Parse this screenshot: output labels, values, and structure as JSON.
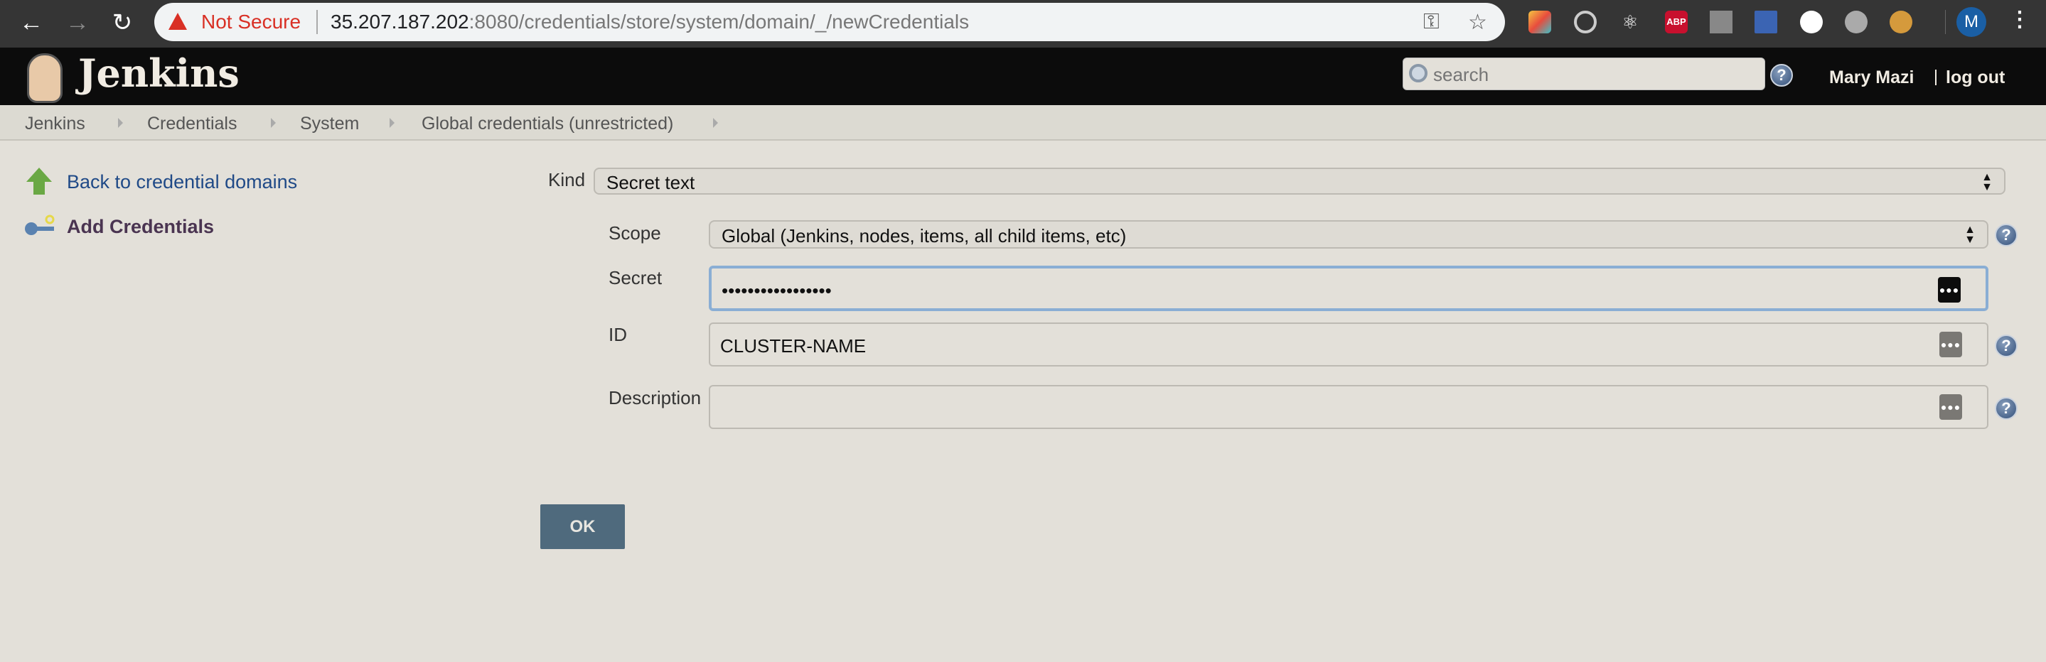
{
  "browser": {
    "security_label": "Not Secure",
    "url_host": "35.207.187.202",
    "url_rest": ":8080/credentials/store/system/domain/_/newCredentials",
    "profile_initial": "M",
    "extensions": [
      "pinwheel",
      "target",
      "react-devtools",
      "adblock-plus",
      "counter",
      "bookmark",
      "json-viewer",
      "ghost",
      "cookie-txt"
    ]
  },
  "header": {
    "logo_text": "Jenkins",
    "search_placeholder": "search",
    "user": "Mary Mazi",
    "logout": "log out"
  },
  "breadcrumb": [
    "Jenkins",
    "Credentials",
    "System",
    "Global credentials (unrestricted)"
  ],
  "sidebar": {
    "back": "Back to credential domains",
    "add": "Add Credentials"
  },
  "form": {
    "kind_label": "Kind",
    "kind_value": "Secret text",
    "scope_label": "Scope",
    "scope_value": "Global (Jenkins, nodes, items, all child items, etc)",
    "secret_label": "Secret",
    "secret_value": "•••••••••••••••••",
    "id_label": "ID",
    "id_value": "CLUSTER-NAME",
    "description_label": "Description",
    "description_value": "",
    "ok": "OK"
  },
  "colors": {
    "header_bg": "#0c0c0c",
    "page_bg": "#e3e0d9",
    "ok_button": "#4f6a7d",
    "link": "#204a87",
    "focus": "#8aaed4"
  }
}
